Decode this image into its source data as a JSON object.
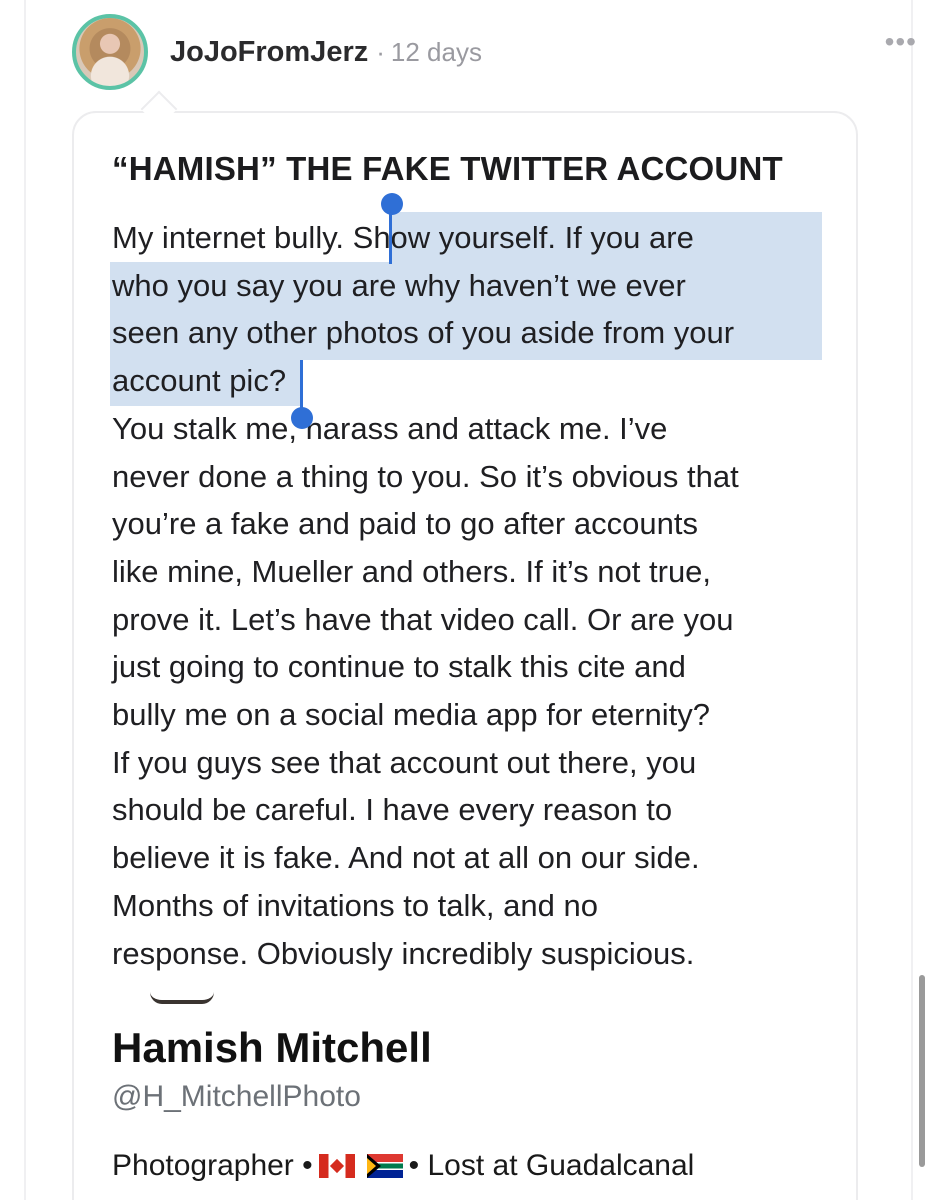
{
  "post": {
    "username": "JoJoFromJerz",
    "separator": "·",
    "time": "12 days",
    "more": "•••",
    "title": "“HAMISH” THE FAKE TWITTER ACCOUNT",
    "lines": [
      {
        "pre": "My internet bully. ",
        "sel": "Show yourself. If you are",
        "post": ""
      },
      {
        "pre": "",
        "sel": "who you say you are why haven’t we ever",
        "post": ""
      },
      {
        "pre": "",
        "sel": "seen any other photos of you aside from your",
        "post": ""
      },
      {
        "pre": "",
        "sel": "account pic?",
        "post": ""
      },
      {
        "pre": "You stalk me, harass and attack me. I’ve",
        "sel": "",
        "post": ""
      },
      {
        "pre": "never done a thing to you. So it’s obvious that",
        "sel": "",
        "post": ""
      },
      {
        "pre": "you’re a fake and paid to go after accounts",
        "sel": "",
        "post": ""
      },
      {
        "pre": "like mine, Mueller and others. If it’s not true,",
        "sel": "",
        "post": ""
      },
      {
        "pre": "prove it. Let’s have that video call. Or are you",
        "sel": "",
        "post": ""
      },
      {
        "pre": "just going to continue to stalk this cite and",
        "sel": "",
        "post": ""
      },
      {
        "pre": "bully me on a social media app for eternity?",
        "sel": "",
        "post": ""
      },
      {
        "pre": "If you guys see that account out there, you",
        "sel": "",
        "post": ""
      },
      {
        "pre": "should be careful. I have every reason to",
        "sel": "",
        "post": ""
      },
      {
        "pre": "believe it is fake. And not at all on our side.",
        "sel": "",
        "post": ""
      },
      {
        "pre": "Months of invitations to talk, and no",
        "sel": "",
        "post": ""
      },
      {
        "pre": "response. Obviously incredibly suspicious.",
        "sel": "",
        "post": ""
      }
    ]
  },
  "embedded_profile": {
    "name": "Hamish Mitchell",
    "handle": "@H_MitchellPhoto",
    "bio_prefix": "Photographer •",
    "bio_suffix": "• Lost at Guadalcanal",
    "flags": [
      "canada-flag",
      "south-africa-flag"
    ]
  },
  "colors": {
    "avatar_ring": "#5bc3a6",
    "selection": "#d2e0f0",
    "selection_handle": "#2f6fd6"
  }
}
